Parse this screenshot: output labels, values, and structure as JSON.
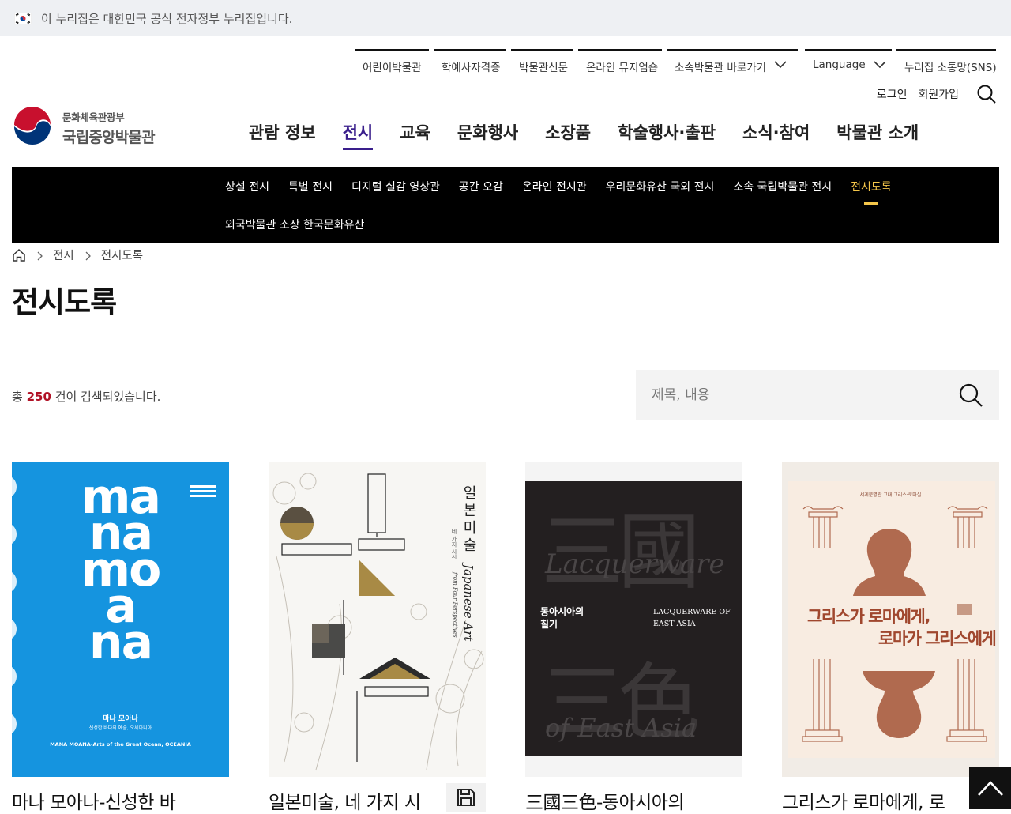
{
  "gov_bar": {
    "text": "이 누리집은 대한민국 공식 전자정부 누리집입니다."
  },
  "utility": [
    {
      "label": "어린이박물관"
    },
    {
      "label": "학예사자격증"
    },
    {
      "label": "박물관신문"
    },
    {
      "label": "온라인 뮤지엄숍"
    },
    {
      "label": "소속박물관 바로가기"
    },
    {
      "label": "Language"
    },
    {
      "label": "누리집 소통망(SNS)"
    }
  ],
  "member": {
    "login": "로그인",
    "join": "회원가입"
  },
  "logo": {
    "ministry": "문화체육관광부",
    "museum": "국립중앙박물관"
  },
  "gnb": [
    "관람 정보",
    "전시",
    "교육",
    "문화행사",
    "소장품",
    "학술행사·출판",
    "소식·참여",
    "박물관 소개"
  ],
  "gnb_active": "전시",
  "subnav": {
    "row1": [
      "상설 전시",
      "특별 전시",
      "디지털 실감 영상관",
      "공간 오감",
      "온라인 전시관",
      "우리문화유산 국외 전시",
      "소속 국립박물관 전시",
      "전시도록"
    ],
    "row2": [
      "외국박물관 소장 한국문화유산"
    ],
    "active": "전시도록"
  },
  "breadcrumb": [
    "전시",
    "전시도록"
  ],
  "page_title": "전시도록",
  "result": {
    "prefix": "총",
    "count": "250",
    "suffix": "건이 검색되었습니다."
  },
  "search": {
    "placeholder": "제목, 내용"
  },
  "cards": [
    {
      "title": "마나 모아나-신성한 바",
      "cover": {
        "big": [
          "ma",
          "na",
          "mo",
          "a",
          "na"
        ],
        "sub1": "마나 모아나",
        "sub2": "신성한 바다의 예술, 오세아니아",
        "sub3": "MANA MOANA-Arts of the Great Ocean, OCEANIA",
        "bg": "#1594df"
      }
    },
    {
      "title": "일본미술, 네 가지 시",
      "cover": {
        "ko_vertical": "일본미술",
        "small_vertical": "네 가지 시선",
        "en_vertical": "Japanese Art",
        "en_sub_vertical": "from Four Perspectives"
      },
      "has_save": true
    },
    {
      "title": "三國三色-동아시아의",
      "cover": {
        "ko": "동아시아의",
        "ko2": "칠기",
        "en": "LACQUERWARE OF",
        "en2": "EAST ASIA",
        "big1": "三國",
        "big2": "三色",
        "script1": "Lacquerware",
        "script2": "of East Asia"
      }
    },
    {
      "title": "그리스가 로마에게, 로",
      "cover": {
        "top": "세계문명관 고대 그리스·로마실",
        "h1": "그리스가 로마에게,",
        "h2": "로마가 그리스에게"
      }
    }
  ]
}
